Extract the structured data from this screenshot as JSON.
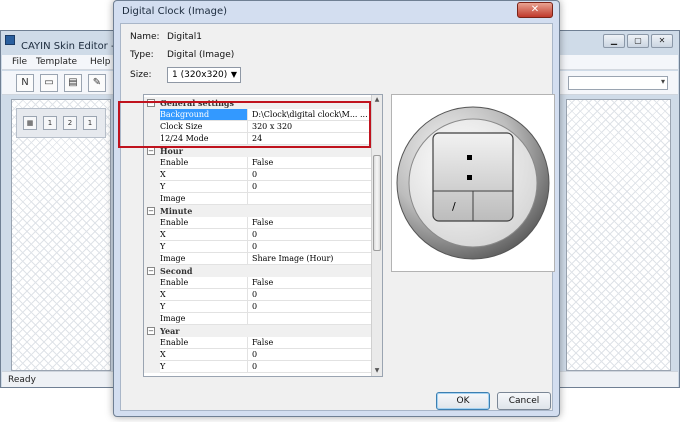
{
  "main_window": {
    "title": "CAYIN Skin Editor - 未",
    "menu": [
      "File",
      "Template",
      "Help"
    ],
    "status": "Ready",
    "window_controls": [
      "minimize-icon",
      "maximize-icon",
      "close-icon"
    ]
  },
  "dialog": {
    "title": "Digital Clock (Image)",
    "close_glyph": "✕",
    "name_label": "Name:",
    "name_value": "Digital1",
    "type_label": "Type:",
    "type_value": "Digital (Image)",
    "size_label": "Size:",
    "size_value": "1  (320x320)",
    "ok_label": "OK",
    "cancel_label": "Cancel"
  },
  "properties": {
    "general": {
      "title": "General settings",
      "background_label": "Background",
      "background_value": "D:\\Clock\\digital clock\\M...  ...",
      "clock_size_label": "Clock Size",
      "clock_size_value": "320 x 320",
      "mode_label": "12/24 Mode",
      "mode_value": "24"
    },
    "hour": {
      "title": "Hour",
      "enable_label": "Enable",
      "enable_value": "False",
      "x_label": "X",
      "x_value": "0",
      "y_label": "Y",
      "y_value": "0",
      "image_label": "Image",
      "image_value": ""
    },
    "minute": {
      "title": "Minute",
      "enable_label": "Enable",
      "enable_value": "False",
      "x_label": "X",
      "x_value": "0",
      "y_label": "Y",
      "y_value": "0",
      "image_label": "Image",
      "image_value": "Share Image (Hour)"
    },
    "second": {
      "title": "Second",
      "enable_label": "Enable",
      "enable_value": "False",
      "x_label": "X",
      "x_value": "0",
      "y_label": "Y",
      "y_value": "0",
      "image_label": "Image",
      "image_value": ""
    },
    "year": {
      "title": "Year",
      "enable_label": "Enable",
      "enable_value": "False",
      "x_label": "X",
      "x_value": "0",
      "y_label": "Y",
      "y_value": "0"
    }
  },
  "preview": {
    "slash": "/",
    "colon": ":"
  },
  "colors": {
    "highlight": "#c0131e",
    "selection": "#3399ff"
  }
}
